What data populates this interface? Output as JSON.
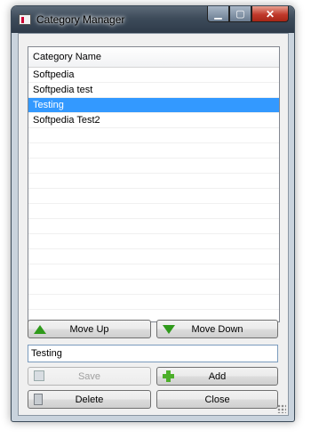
{
  "window": {
    "title": "Category Manager"
  },
  "list": {
    "column_header": "Category Name",
    "items": [
      "Softpedia",
      "Softpedia test",
      "Testing",
      "Softpedia Test2"
    ],
    "selected_index": 2
  },
  "buttons": {
    "move_up": "Move Up",
    "move_down": "Move Down",
    "save": "Save",
    "add": "Add",
    "delete": "Delete",
    "close": "Close"
  },
  "input": {
    "value": "Testing"
  },
  "icons": {
    "move_up": "green-up-triangle-icon",
    "move_down": "green-down-triangle-icon",
    "save": "floppy-disk-icon",
    "add": "green-plus-icon",
    "delete": "trash-bin-icon"
  },
  "colors": {
    "selection": "#3399ff",
    "arrow_green": "#2f9a1b"
  }
}
